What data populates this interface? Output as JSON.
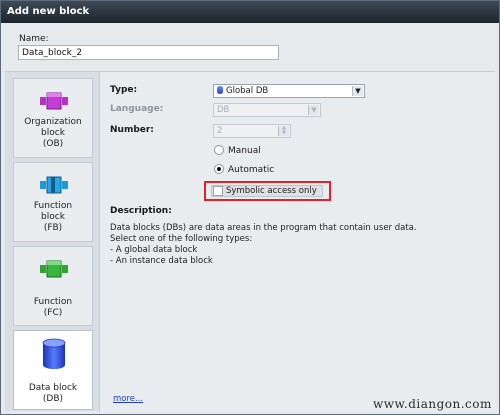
{
  "dialog": {
    "title": "Add new block"
  },
  "name": {
    "label": "Name:",
    "value": "Data_block_2"
  },
  "blocks": [
    {
      "label_lines": [
        "Organization",
        "block",
        "(OB)"
      ],
      "icon": "organization-block-icon",
      "color": "#b830c8"
    },
    {
      "label_lines": [
        "Function",
        "block",
        "(FB)"
      ],
      "icon": "function-block-icon",
      "color": "#1e9ad6"
    },
    {
      "label_lines": [
        "Function",
        "(FC)"
      ],
      "icon": "function-icon",
      "color": "#2fa631"
    },
    {
      "label_lines": [
        "Data block",
        "(DB)"
      ],
      "icon": "data-block-icon",
      "color": "#2d4fd6",
      "selected": true
    }
  ],
  "form": {
    "type_label": "Type:",
    "type_value": "Global DB",
    "language_label": "Language:",
    "language_value": "DB",
    "number_label": "Number:",
    "number_value": "2",
    "manual_label": "Manual",
    "automatic_label": "Automatic",
    "numbering_mode": "Automatic",
    "symbolic_label": "Symbolic access only",
    "symbolic_checked": false
  },
  "description": {
    "title": "Description:",
    "lines": [
      "Data blocks (DBs) are data areas in the program that contain user data.",
      "Select one of the following types:",
      "- A global data block",
      "- An instance data block"
    ]
  },
  "more_link": "more...",
  "watermark": "www.diangon.com",
  "colors": {
    "highlight_border": "#e0232b",
    "title_bar": "#2b333c",
    "link": "#1f3fbf"
  }
}
